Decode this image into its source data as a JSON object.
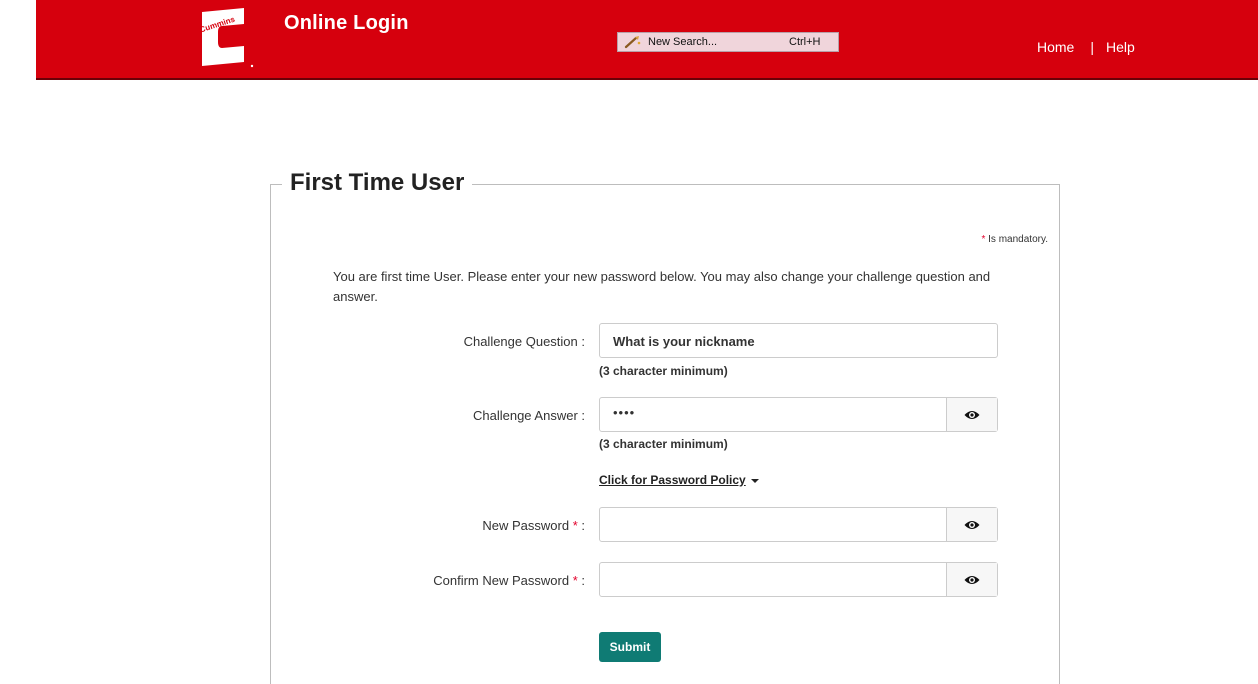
{
  "header": {
    "app_title": "Online Login",
    "quick_search": {
      "label": "New Search...",
      "shortcut": "Ctrl+H"
    },
    "nav": {
      "home": "Home",
      "separator": "|",
      "help": "Help"
    },
    "brand_color": "#d6000d"
  },
  "form": {
    "title": "First Time User",
    "mandatory_star": "*",
    "mandatory_note": "Is mandatory.",
    "intro": "You are first time User. Please enter your new password below. You may also change your challenge question and answer.",
    "challenge_question": {
      "label": "Challenge Question :",
      "value": "What is your nickname",
      "hint": "(3 character minimum)"
    },
    "challenge_answer": {
      "label": "Challenge Answer :",
      "value": "••••",
      "hint": "(3 character minimum)",
      "toggle_icon": "eye-icon"
    },
    "password_policy_link": "Click for Password Policy",
    "new_password": {
      "label": "New Password",
      "required_mark": "*",
      "colon": " :",
      "value": "",
      "toggle_icon": "eye-icon"
    },
    "confirm_password": {
      "label": "Confirm New Password",
      "required_mark": "*",
      "colon": " :",
      "value": "",
      "toggle_icon": "eye-icon"
    },
    "submit_label": "Submit",
    "submit_color": "#0f7b74"
  }
}
